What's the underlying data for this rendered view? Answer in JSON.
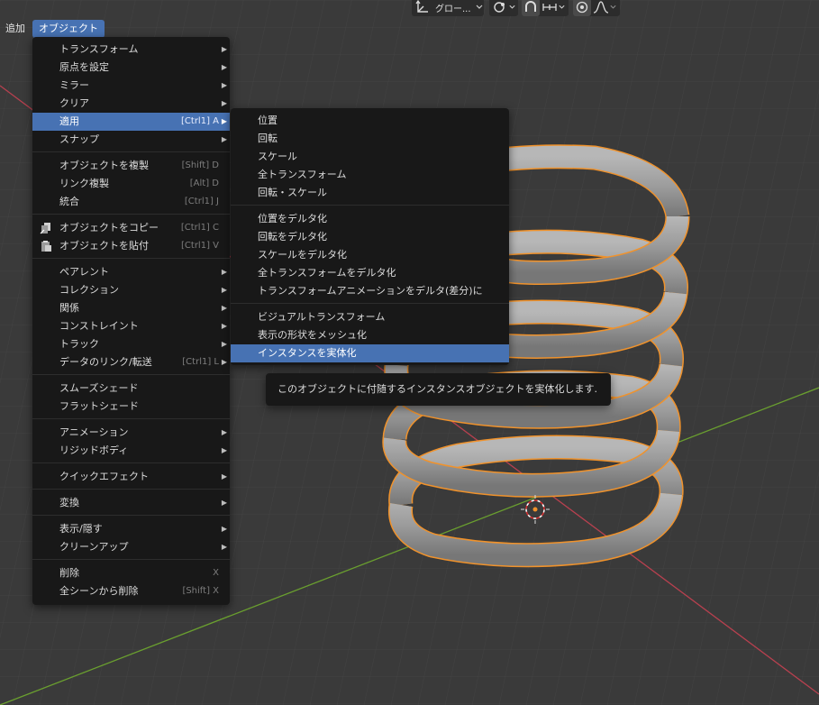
{
  "header": {
    "add_label": "追加",
    "object_label": "オブジェクト",
    "transform_orientation": "グロー..."
  },
  "object_menu": {
    "items": [
      {
        "label": "トランスフォーム",
        "shortcut": "",
        "submenu": true
      },
      {
        "label": "原点を設定",
        "shortcut": "",
        "submenu": true
      },
      {
        "label": "ミラー",
        "shortcut": "",
        "submenu": true
      },
      {
        "label": "クリア",
        "shortcut": "",
        "submenu": true
      },
      {
        "label": "適用",
        "shortcut": "[Ctrl1] A",
        "submenu": true,
        "highlighted": true
      },
      {
        "label": "スナップ",
        "shortcut": "",
        "submenu": true
      },
      {
        "label": "オブジェクトを複製",
        "shortcut": "[Shift] D",
        "submenu": false
      },
      {
        "label": "リンク複製",
        "shortcut": "[Alt] D",
        "submenu": false
      },
      {
        "label": "統合",
        "shortcut": "[Ctrl1] J",
        "submenu": false
      },
      {
        "label": "オブジェクトをコピー",
        "shortcut": "[Ctrl1] C",
        "submenu": false,
        "icon": "copy-icon"
      },
      {
        "label": "オブジェクトを貼付",
        "shortcut": "[Ctrl1] V",
        "submenu": false,
        "icon": "paste-icon"
      },
      {
        "label": "ペアレント",
        "shortcut": "",
        "submenu": true
      },
      {
        "label": "コレクション",
        "shortcut": "",
        "submenu": true
      },
      {
        "label": "関係",
        "shortcut": "",
        "submenu": true
      },
      {
        "label": "コンストレイント",
        "shortcut": "",
        "submenu": true
      },
      {
        "label": "トラック",
        "shortcut": "",
        "submenu": true
      },
      {
        "label": "データのリンク/転送",
        "shortcut": "[Ctrl1] L",
        "submenu": true
      },
      {
        "label": "スムーズシェード",
        "shortcut": "",
        "submenu": false
      },
      {
        "label": "フラットシェード",
        "shortcut": "",
        "submenu": false
      },
      {
        "label": "アニメーション",
        "shortcut": "",
        "submenu": true
      },
      {
        "label": "リジッドボディ",
        "shortcut": "",
        "submenu": true
      },
      {
        "label": "クイックエフェクト",
        "shortcut": "",
        "submenu": true
      },
      {
        "label": "変換",
        "shortcut": "",
        "submenu": true
      },
      {
        "label": "表示/隠す",
        "shortcut": "",
        "submenu": true
      },
      {
        "label": "クリーンアップ",
        "shortcut": "",
        "submenu": true
      },
      {
        "label": "削除",
        "shortcut": "X",
        "submenu": false
      },
      {
        "label": "全シーンから削除",
        "shortcut": "[Shift] X",
        "submenu": false
      }
    ]
  },
  "apply_submenu": {
    "items": [
      {
        "label": "位置"
      },
      {
        "label": "回転"
      },
      {
        "label": "スケール"
      },
      {
        "label": "全トランスフォーム"
      },
      {
        "label": "回転・スケール"
      },
      {
        "label": "位置をデルタ化"
      },
      {
        "label": "回転をデルタ化"
      },
      {
        "label": "スケールをデルタ化"
      },
      {
        "label": "全トランスフォームをデルタ化"
      },
      {
        "label": "トランスフォームアニメーションをデルタ(差分)に"
      },
      {
        "label": "ビジュアルトランスフォーム"
      },
      {
        "label": "表示の形状をメッシュ化"
      },
      {
        "label": "インスタンスを実体化",
        "highlighted": true
      }
    ]
  },
  "tooltip": {
    "text": "このオブジェクトに付随するインスタンスオブジェクトを実体化します."
  },
  "colors": {
    "accent": "#4772b3",
    "selection_outline": "#f0922b",
    "x_axis": "#b8404f",
    "y_axis": "#6a9f2f",
    "menu_bg": "#181818",
    "viewport_bg": "#3b3b3b"
  }
}
